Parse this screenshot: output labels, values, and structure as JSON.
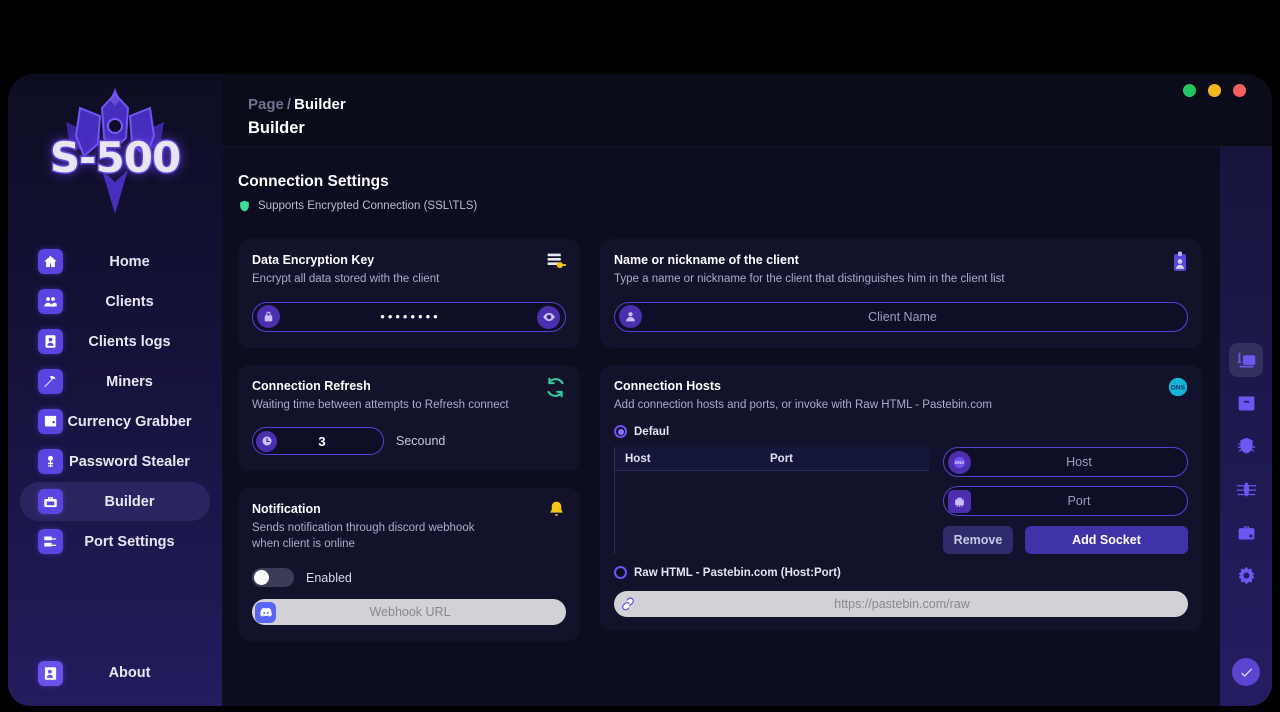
{
  "app": {
    "logo_text": "S-500"
  },
  "window_controls": [
    {
      "name": "minimize",
      "color": "#22c55e"
    },
    {
      "name": "maximize",
      "color": "#f5b820"
    },
    {
      "name": "close",
      "color": "#f4605e"
    }
  ],
  "sidebar": {
    "items": [
      {
        "label": "Home",
        "icon": "home-icon",
        "active": false
      },
      {
        "label": "Clients",
        "icon": "users-icon",
        "active": false
      },
      {
        "label": "Clients logs",
        "icon": "user-card-icon",
        "active": false
      },
      {
        "label": "Miners",
        "icon": "pickaxe-icon",
        "active": false
      },
      {
        "label": "Currency Grabber",
        "icon": "wallet-icon",
        "active": false
      },
      {
        "label": "Password Stealer",
        "icon": "key-icon",
        "active": false
      },
      {
        "label": "Builder",
        "icon": "toolbox-icon",
        "active": true
      },
      {
        "label": "Port Settings",
        "icon": "network-icon",
        "active": false
      }
    ],
    "about": {
      "label": "About",
      "icon": "info-user-icon"
    }
  },
  "header": {
    "breadcrumb_parent": "Page",
    "breadcrumb_sep": "/",
    "breadcrumb_current": "Builder",
    "page_title": "Builder"
  },
  "section": {
    "title": "Connection Settings",
    "ssl_note": "Supports Encrypted Connection (SSL\\TLS)",
    "ssl_icon": "shield-icon",
    "ssl_color": "#3ddc97"
  },
  "encryption_card": {
    "title": "Data Encryption Key",
    "subtitle": "Encrypt all data stored with the client",
    "icon": "key-file-icon",
    "input": {
      "value": "••••••••",
      "lead_icon": "lock-icon",
      "trail_icon": "eye-icon"
    }
  },
  "refresh_card": {
    "title": "Connection Refresh",
    "subtitle": "Waiting time between attempts to Refresh connect",
    "icon": "refresh-icon",
    "icon_color": "#2ecc9b",
    "input": {
      "value": "3",
      "lead_icon": "clock-icon"
    },
    "unit_label": "Secound"
  },
  "notification_card": {
    "title": "Notification",
    "subtitle": "Sends notification through discord webhook\n when client is online",
    "icon": "bell-icon",
    "icon_color": "#f5c518",
    "toggle": {
      "label": "Enabled",
      "enabled": false
    },
    "webhook_input": {
      "placeholder": "Webhook URL",
      "lead_icon": "discord-icon"
    }
  },
  "client_name_card": {
    "title": "Name or nickname of the client",
    "subtitle": "Type a name or nickname for the client that distinguishes him in the client list",
    "icon": "id-badge-icon",
    "input": {
      "placeholder": "Client Name",
      "lead_icon": "person-icon"
    }
  },
  "hosts_card": {
    "title": "Connection Hosts",
    "subtitle": "Add connection hosts and ports, or invoke with Raw HTML - Pastebin.com",
    "icon": "dns-icon",
    "radio_default": {
      "label": "Defaul",
      "selected": true
    },
    "table": {
      "columns": [
        "Host",
        "Port"
      ],
      "rows": []
    },
    "host_input": {
      "placeholder": "Host",
      "lead_icon": "dns-icon"
    },
    "port_input": {
      "placeholder": "Port",
      "lead_icon": "ethernet-icon"
    },
    "remove_button": "Remove",
    "add_button": "Add Socket",
    "radio_raw": {
      "label": "Raw HTML - Pastebin.com (Host:Port)",
      "selected": false
    },
    "raw_input": {
      "placeholder": "https://pastebin.com/raw",
      "lead_icon": "link-icon"
    }
  },
  "rail": {
    "buttons": [
      {
        "icon": "builder-icon",
        "active": true
      },
      {
        "icon": "package-icon",
        "active": false
      },
      {
        "icon": "shield-bug-icon",
        "active": false
      },
      {
        "icon": "spider-icon",
        "active": false
      },
      {
        "icon": "briefcase-icon",
        "active": false
      },
      {
        "icon": "gear-icon",
        "active": false
      }
    ],
    "confirm": {
      "icon": "check-icon"
    }
  }
}
